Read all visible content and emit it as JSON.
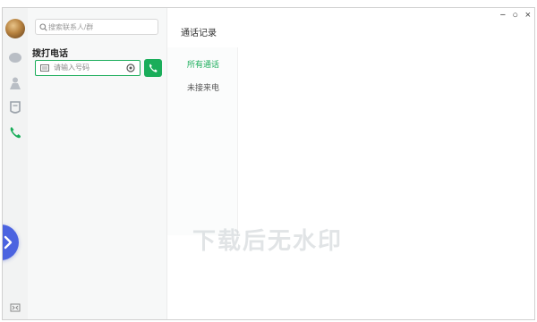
{
  "search": {
    "placeholder": "搜索联系人/群"
  },
  "dialer": {
    "title": "拨打电话",
    "input_placeholder": "请输入号码"
  },
  "right_panel": {
    "title": "通话记录",
    "tabs": [
      {
        "label": "所有通话",
        "active": true
      },
      {
        "label": "未接来电",
        "active": false
      }
    ]
  },
  "watermark": "下载后无水印",
  "window_controls": {
    "minimize": "−",
    "maximize": "○",
    "close": "×"
  },
  "colors": {
    "accent": "#1aad5a",
    "floating_button": "#4b63e0"
  },
  "icons": {
    "rail": [
      "chat-bubble-icon",
      "contacts-icon",
      "favorites-icon",
      "phone-icon"
    ],
    "bottom": "expand-icon"
  }
}
